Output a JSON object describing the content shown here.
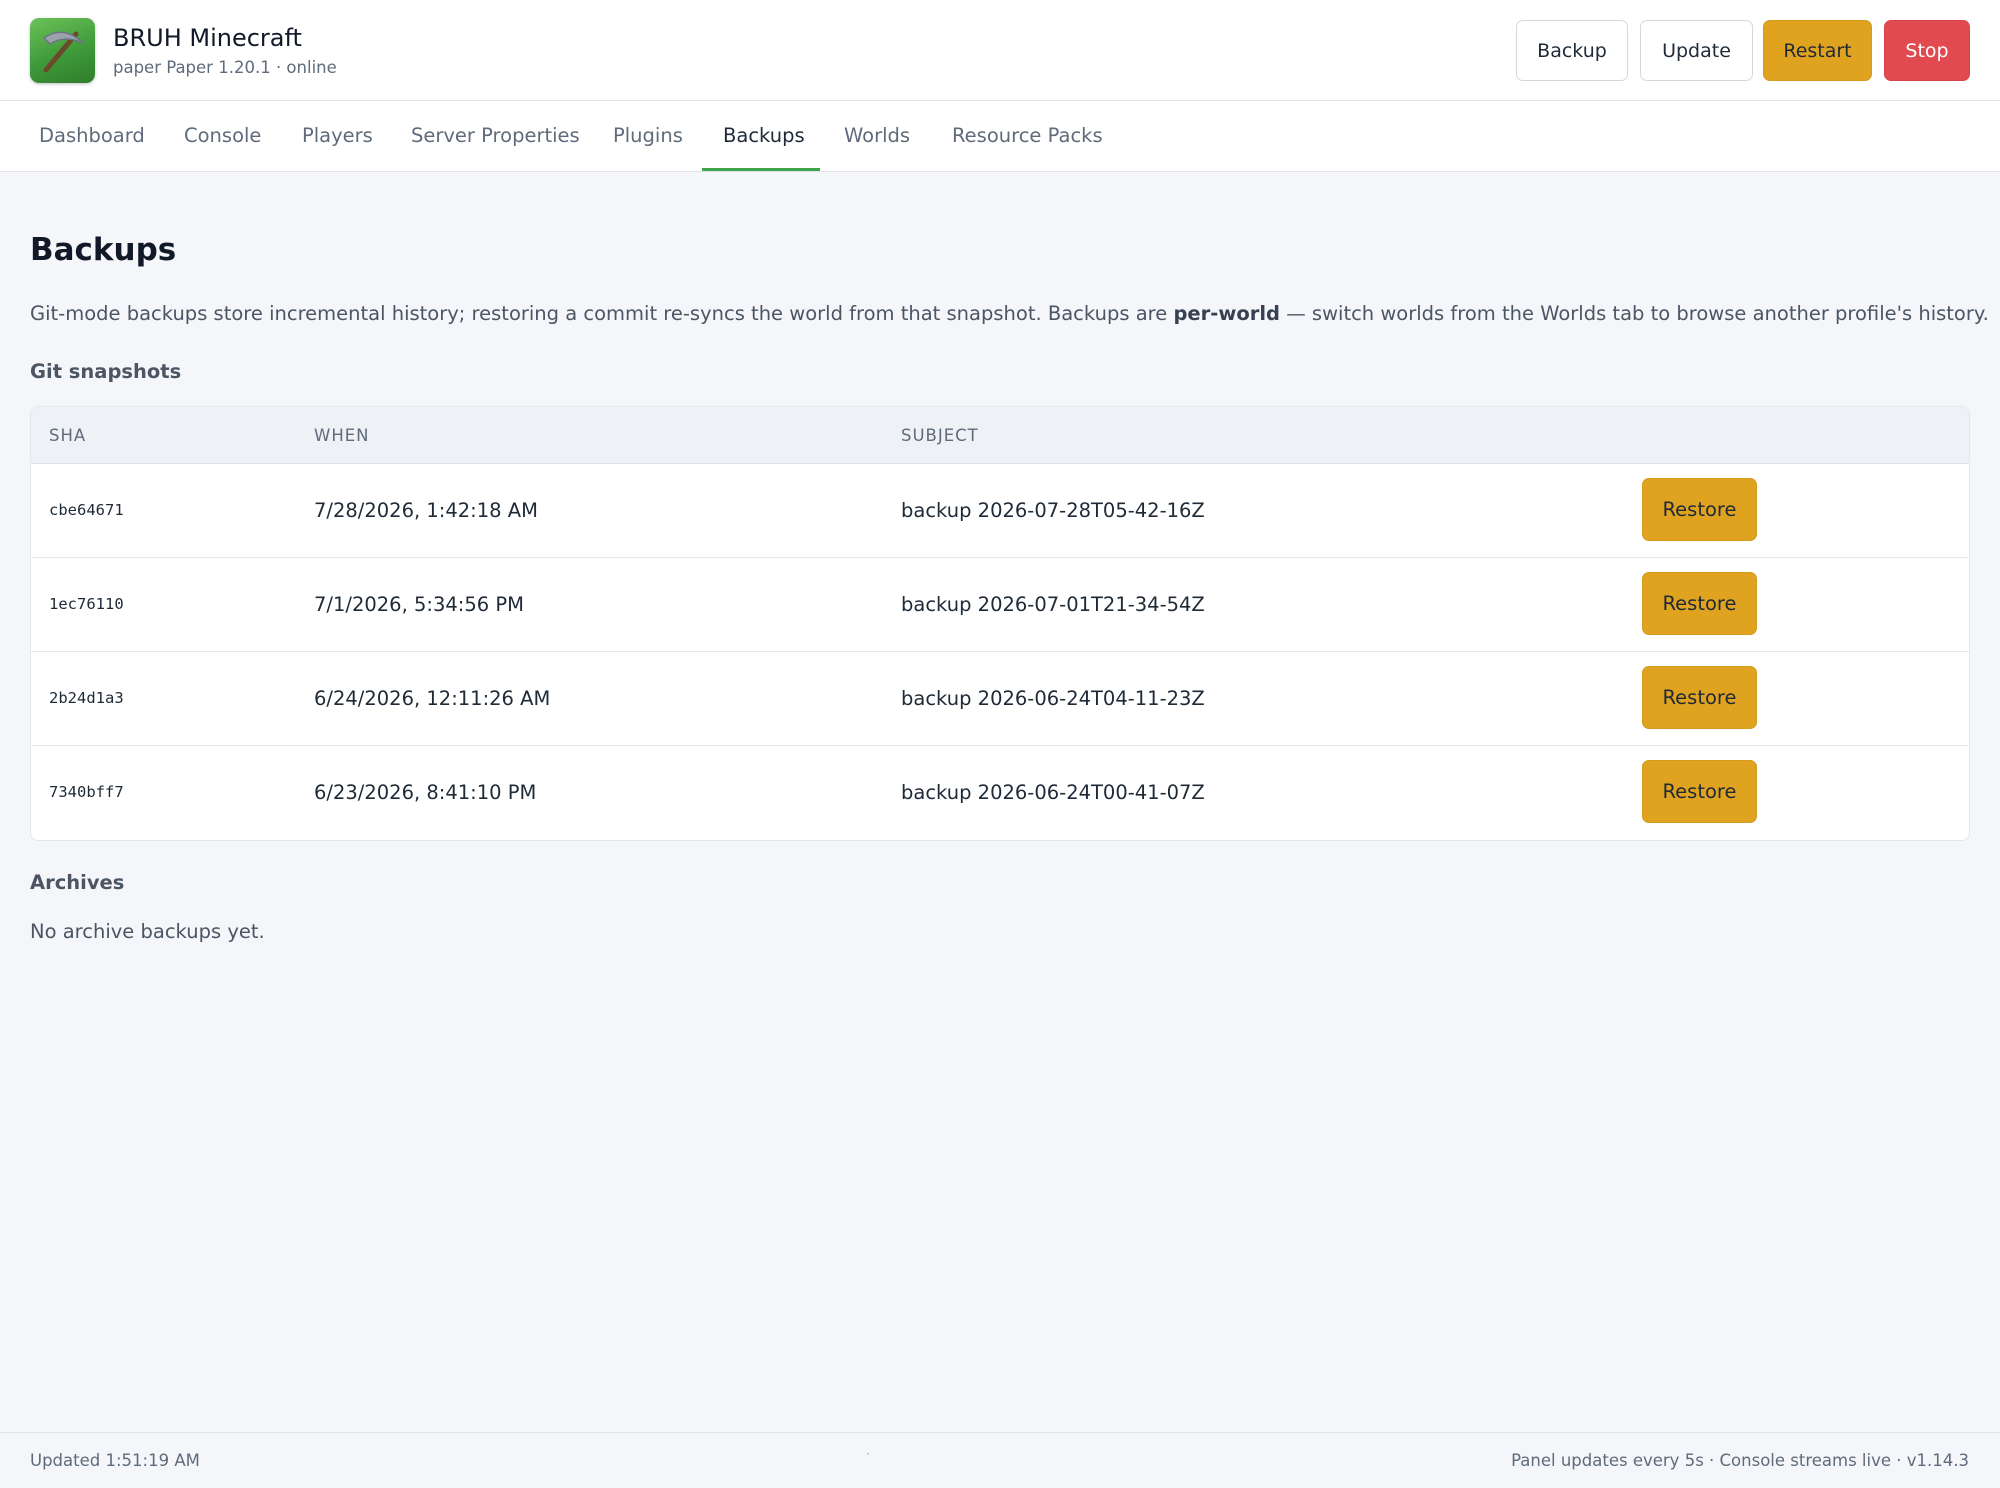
{
  "header": {
    "title": "BRUH Minecraft",
    "subtitle": "paper Paper 1.20.1 · online",
    "logo_icon": "pickaxe-icon",
    "buttons": {
      "backup": "Backup",
      "update": "Update",
      "restart": "Restart",
      "stop": "Stop"
    }
  },
  "tabs": [
    {
      "label": "Dashboard"
    },
    {
      "label": "Console"
    },
    {
      "label": "Players"
    },
    {
      "label": "Server Properties"
    },
    {
      "label": "Plugins"
    },
    {
      "label": "Backups"
    },
    {
      "label": "Worlds"
    },
    {
      "label": "Resource Packs"
    }
  ],
  "active_tab": "Backups",
  "page": {
    "title": "Backups",
    "description_before": "Git-mode backups store incremental history; restoring a commit re-syncs the world from that snapshot. Backups are ",
    "description_bold": "per-world",
    "description_after": " — switch worlds from the Worlds tab to browse another profile's history."
  },
  "git": {
    "heading": "Git snapshots",
    "columns": {
      "sha": "SHA",
      "when": "WHEN",
      "subject": "SUBJECT"
    },
    "rows": [
      {
        "sha": "cbe64671",
        "when": "7/28/2026, 1:42:18 AM",
        "subject": "backup 2026-07-28T05-42-16Z",
        "action": "Restore"
      },
      {
        "sha": "1ec76110",
        "when": "7/1/2026, 5:34:56 PM",
        "subject": "backup 2026-07-01T21-34-54Z",
        "action": "Restore"
      },
      {
        "sha": "2b24d1a3",
        "when": "6/24/2026, 12:11:26 AM",
        "subject": "backup 2026-06-24T04-11-23Z",
        "action": "Restore"
      },
      {
        "sha": "7340bff7",
        "when": "6/23/2026, 8:41:10 PM",
        "subject": "backup 2026-06-24T00-41-07Z",
        "action": "Restore"
      }
    ]
  },
  "archives": {
    "heading": "Archives",
    "empty_text": "No archive backups yet."
  },
  "footer": {
    "updated": "Updated 1:51:19 AM",
    "separator": "·",
    "right": "Panel updates every 5s · Console streams live · v1.14.3"
  },
  "colors": {
    "accent_green": "#3fa34d",
    "warning": "#e0a31f",
    "danger": "#e04a50",
    "background": "#f4f6f9"
  }
}
